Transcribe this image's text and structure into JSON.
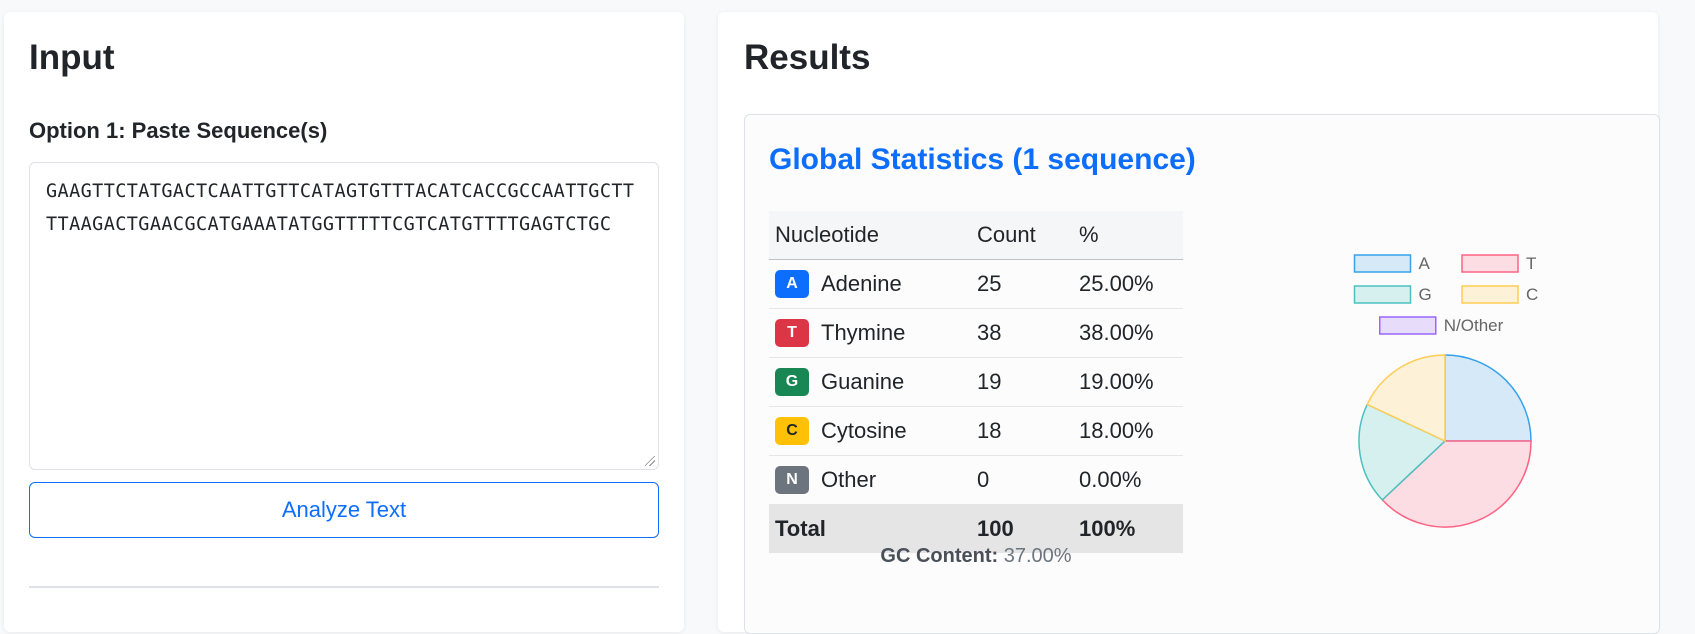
{
  "input": {
    "heading": "Input",
    "option1_label": "Option 1: Paste Sequence(s)",
    "sequence_value": "GAAGTTCTATGACTCAATTGTTCATAGTGTTTACATCACCGCCAATTGCTTTTAAGACTGAACGCATGAAATATGGTTTTTCGTCATGTTTTGAGTCTGC",
    "analyze_button": "Analyze Text"
  },
  "results": {
    "heading": "Results",
    "stats_title": "Global Statistics (1 sequence)",
    "table": {
      "headers": [
        "Nucleotide",
        "Count",
        "%"
      ],
      "rows": [
        {
          "badge": "A",
          "name": "Adenine",
          "count": "25",
          "pct": "25.00%",
          "color": "#0d6efd",
          "badge_text": "#ffffff"
        },
        {
          "badge": "T",
          "name": "Thymine",
          "count": "38",
          "pct": "38.00%",
          "color": "#dc3545",
          "badge_text": "#ffffff"
        },
        {
          "badge": "G",
          "name": "Guanine",
          "count": "19",
          "pct": "19.00%",
          "color": "#198754",
          "badge_text": "#ffffff"
        },
        {
          "badge": "C",
          "name": "Cytosine",
          "count": "18",
          "pct": "18.00%",
          "color": "#ffc107",
          "badge_text": "#212529"
        },
        {
          "badge": "N",
          "name": "Other",
          "count": "0",
          "pct": "0.00%",
          "color": "#6c757d",
          "badge_text": "#ffffff"
        }
      ],
      "total": {
        "label": "Total",
        "count": "100",
        "pct": "100%"
      }
    },
    "gc_label": "GC Content:",
    "gc_value": "37.00%"
  },
  "chart_data": {
    "type": "pie",
    "categories": [
      "A",
      "T",
      "G",
      "C",
      "N/Other"
    ],
    "values": [
      25,
      38,
      19,
      18,
      0
    ],
    "fill_colors": [
      "#d6e9f8",
      "#fbdde3",
      "#d5f0ee",
      "#fdf2d7",
      "#e8dcfb"
    ],
    "border_colors": [
      "#36a2eb",
      "#ff6384",
      "#4bc0c0",
      "#ffcd56",
      "#9966ff"
    ],
    "legend_position": "top"
  }
}
